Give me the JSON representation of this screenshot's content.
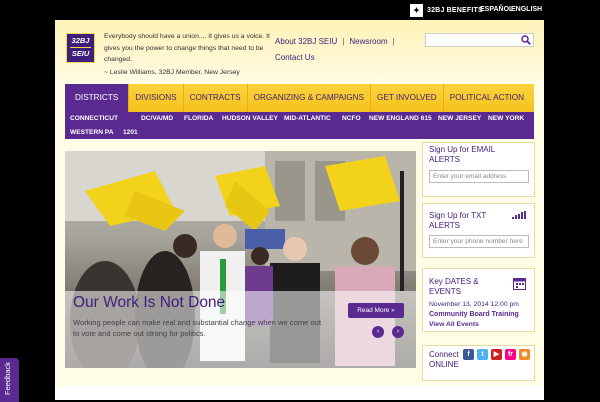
{
  "topbar": {
    "benefits_label": "32BJ BENEFITS",
    "lang_es": "ESPAÑOL",
    "lang_en": "ENGLISH"
  },
  "header": {
    "logo_line1": "32BJ",
    "logo_line2": "SEIU",
    "quote": "Everybody should have a union.... It gives us a voice. It gives you the power to change things that need to be changed.",
    "quote_attrib": "~ Leslie Williams, 32BJ Member, New Jersey",
    "links": [
      "About 32BJ SEIU",
      "Newsroom",
      "Contact Us"
    ],
    "search_placeholder": ""
  },
  "nav": {
    "items": [
      "DISTRICTS",
      "DIVISIONS",
      "CONTRACTS",
      "ORGANIZING & CAMPAIGNS",
      "GET INVOLVED",
      "POLITICAL ACTION"
    ],
    "active": "DISTRICTS"
  },
  "subnav": {
    "items": [
      "CONNECTICUT",
      "DC/VA/MD",
      "FLORIDA",
      "HUDSON VALLEY",
      "MID-ATLANTIC",
      "NCFO",
      "NEW ENGLAND 615",
      "NEW JERSEY",
      "NEW YORK",
      "WESTERN PA",
      "1201"
    ]
  },
  "hero": {
    "title": "Our Work Is Not Done",
    "text": "Working people can make real and substantial change when we come out to vote and come out strong for politics.",
    "read_more": "Read More »",
    "prev": "‹",
    "next": "›"
  },
  "sidebar": {
    "email_alerts": {
      "title_line1": "Sign Up for EMAIL",
      "title_line2": "ALERTS",
      "placeholder": "Enter your email address"
    },
    "txt_alerts": {
      "title_line1": "Sign Up for TXT",
      "title_line2": "ALERTS",
      "placeholder": "Enter your phone number here"
    },
    "events": {
      "title_line1": "Key DATES &",
      "title_line2": "EVENTS",
      "date": "November 13, 2014 12:00 pm",
      "event_title": "Community Board Training",
      "view_all": "View All Events"
    },
    "connect": {
      "title_line1": "Connect",
      "title_line2": "ONLINE",
      "icons": [
        "facebook-icon",
        "twitter-icon",
        "youtube-icon",
        "flickr-icon",
        "rss-icon"
      ],
      "icon_glyphs": [
        "f",
        "t",
        "▶",
        "fr",
        "◉"
      ],
      "icon_colors": [
        "#3b5998",
        "#4ab3f4",
        "#cc2020",
        "#ff0084",
        "#f08a24"
      ]
    }
  },
  "feedback": {
    "label": "Feedback"
  },
  "colors": {
    "purple": "#5b2a91",
    "gold": "#f6c21e",
    "cream": "#fffde6"
  }
}
